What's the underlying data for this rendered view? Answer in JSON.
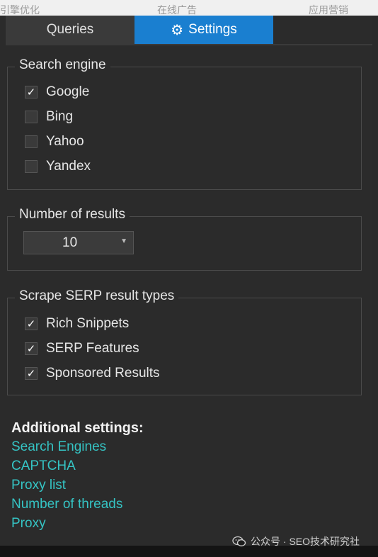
{
  "background": {
    "top_strip": [
      "引擎优化",
      "在线广告",
      "应用营销"
    ]
  },
  "tabs": [
    {
      "label": "Queries",
      "active": false
    },
    {
      "label": "Settings",
      "active": true,
      "icon": "gear-icon"
    }
  ],
  "search_engine": {
    "title": "Search engine",
    "options": [
      {
        "label": "Google",
        "checked": true
      },
      {
        "label": "Bing",
        "checked": false
      },
      {
        "label": "Yahoo",
        "checked": false
      },
      {
        "label": "Yandex",
        "checked": false
      }
    ]
  },
  "number_of_results": {
    "title": "Number of results",
    "selected": "10"
  },
  "serp_types": {
    "title": "Scrape SERP result types",
    "options": [
      {
        "label": "Rich Snippets",
        "checked": true
      },
      {
        "label": "SERP Features",
        "checked": true
      },
      {
        "label": "Sponsored Results",
        "checked": true
      }
    ]
  },
  "additional": {
    "title": "Additional settings:",
    "links": [
      "Search Engines",
      "CAPTCHA",
      "Proxy list",
      "Number of threads",
      "Proxy"
    ]
  },
  "watermark": {
    "text": "公众号 · SEO技术研究社"
  },
  "colors": {
    "accent": "#1a7fd0",
    "link": "#35c4c4",
    "panel_bg": "#2b2b2b"
  }
}
